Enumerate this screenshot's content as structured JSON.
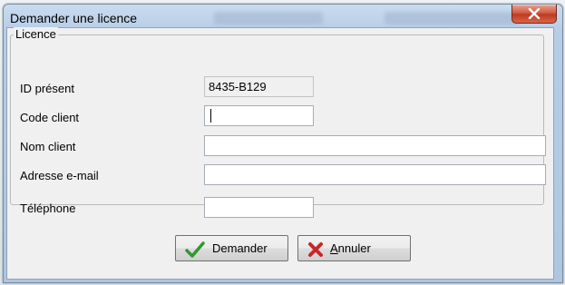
{
  "window": {
    "title": "Demander une licence"
  },
  "group": {
    "legend": "Licence"
  },
  "fields": {
    "id_label": "ID présent",
    "id_value": "8435-B129",
    "code_label": "Code client",
    "code_value": "",
    "name_label": "Nom client",
    "name_value": "",
    "email_label": "Adresse e-mail",
    "email_value": "",
    "phone_label": "Téléphone",
    "phone_value": ""
  },
  "buttons": {
    "request_label": "Demander",
    "cancel_first": "A",
    "cancel_rest": "nnuler"
  },
  "colors": {
    "check": "#2e9a2e",
    "cross": "#c62828",
    "close": "#c0391f"
  },
  "icons": {
    "close": "close-icon",
    "request": "check-icon",
    "cancel": "cross-icon"
  }
}
